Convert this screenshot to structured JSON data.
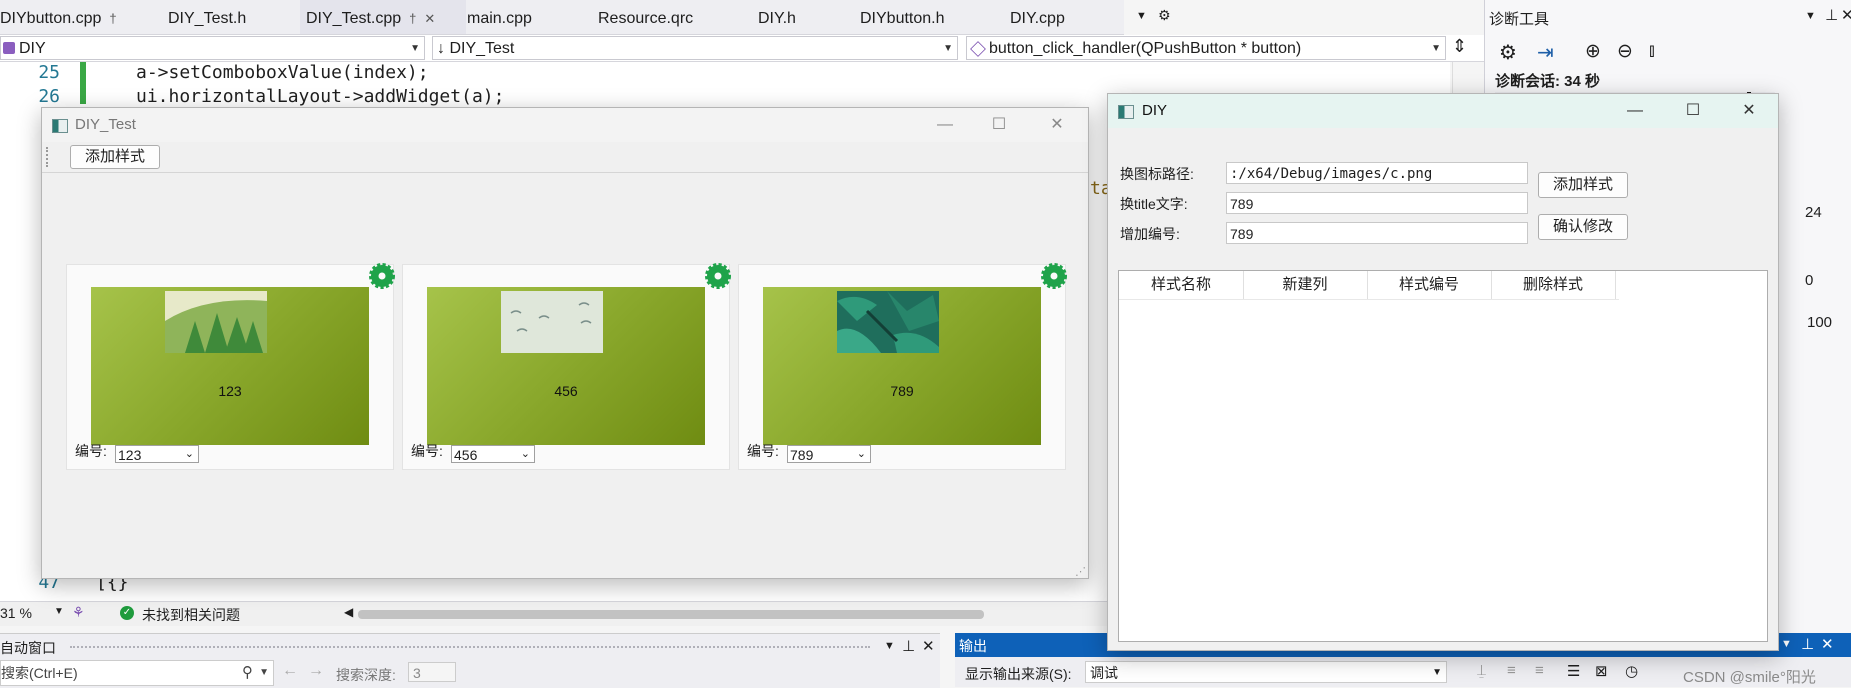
{
  "ide": {
    "tabs": [
      "DIYbutton.cpp",
      "DIY_Test.h",
      "DIY_Test.cpp",
      "main.cpp",
      "Resource.qrc",
      "DIY.h",
      "DIYbutton.h",
      "DIY.cpp"
    ],
    "pin_glyph": "†",
    "close_glyph": "✕",
    "nav": {
      "scope": "DIY",
      "class": "↓ DIY_Test",
      "member": "button_click_handler(QPushButton * button)"
    },
    "code": [
      {
        "num": "25",
        "text": "a->setComboboxValue(index);"
      },
      {
        "num": "26",
        "text": "ui.horizontalLayout->addWidget(a);"
      }
    ],
    "code_fragment": "ta",
    "line47": {
      "num": "47",
      "text": "[{}"
    },
    "status": {
      "zoom": "31 %",
      "issues": "未找到相关问题"
    },
    "diag": {
      "title": "诊断工具",
      "session": "诊断会话: 34 秒",
      "v24": "24",
      "v0": "0",
      "v100": "100"
    },
    "autowin": {
      "title": "自动窗口",
      "search_placeholder": "搜索(Ctrl+E)",
      "depth_label": "搜索深度:",
      "depth_value": "3"
    },
    "output": {
      "title": "输出",
      "source_label": "显示输出来源(S):",
      "source_value": "调试"
    },
    "watermark": "CSDN @smile°阳光"
  },
  "diy_test": {
    "title": "DIY_Test",
    "add_style": "添加样式",
    "cards": [
      {
        "text": "123",
        "label": "编号:",
        "value": "123"
      },
      {
        "text": "456",
        "label": "编号:",
        "value": "456"
      },
      {
        "text": "789",
        "label": "编号:",
        "value": "789"
      }
    ]
  },
  "diy": {
    "title": "DIY",
    "icon_path_label": "换图标路径:",
    "icon_path_value": ":/x64/Debug/images/c.png",
    "title_text_label": "换title文字:",
    "title_text_value": "789",
    "add_number_label": "增加编号:",
    "add_number_value": "789",
    "add_style_button": "添加样式",
    "confirm_button": "确认修改",
    "table_headers": [
      "样式名称",
      "新建列",
      "样式编号",
      "删除样式"
    ]
  }
}
